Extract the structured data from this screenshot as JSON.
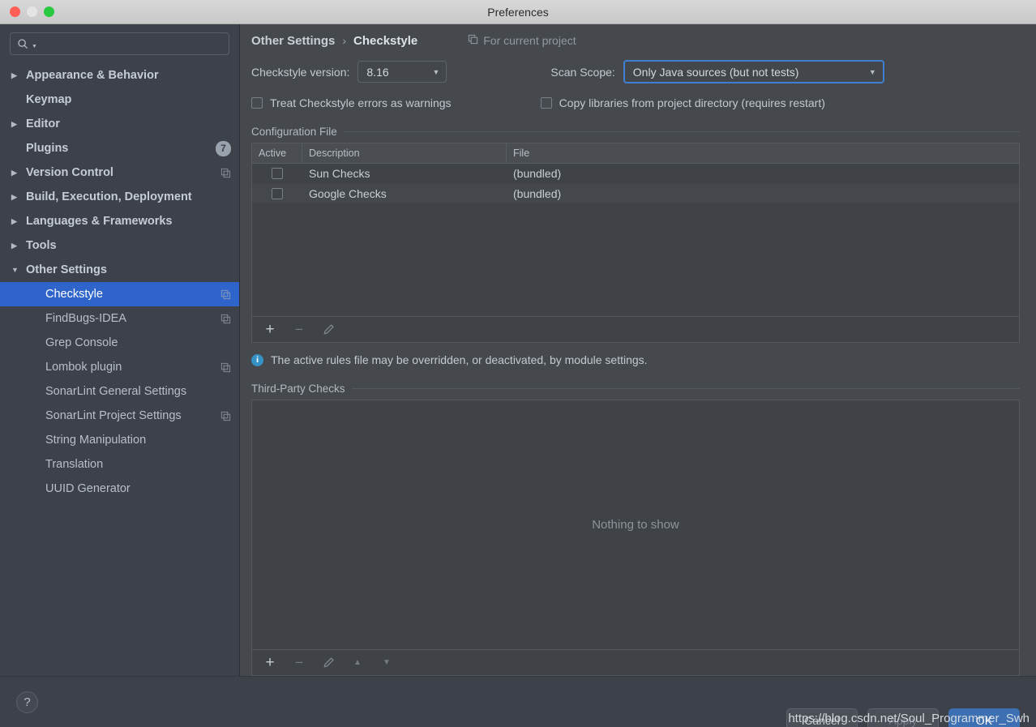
{
  "window": {
    "title": "Preferences",
    "traffic_lights": [
      "close",
      "minimize",
      "maximize"
    ],
    "colors": {
      "accent_selected": "#2f65ca",
      "accent_focus_border": "#3f7fd1",
      "primary_button": "#3d6fb3",
      "info_icon": "#3592c4",
      "sidebar_bg": "#3c414a",
      "content_bg": "#45494d"
    }
  },
  "sidebar": {
    "search": {
      "value": "",
      "placeholder": "",
      "icon": "search-icon",
      "dropdown_icon": "chevron-down-icon"
    },
    "items": [
      {
        "label": "Appearance & Behavior",
        "twisty": "▶",
        "level": 0,
        "selected": false,
        "badge": null,
        "module_icon": false
      },
      {
        "label": "Keymap",
        "twisty": "",
        "level": 0,
        "selected": false,
        "badge": null,
        "module_icon": false
      },
      {
        "label": "Editor",
        "twisty": "▶",
        "level": 0,
        "selected": false,
        "badge": null,
        "module_icon": false
      },
      {
        "label": "Plugins",
        "twisty": "",
        "level": 0,
        "selected": false,
        "badge": "7",
        "module_icon": false
      },
      {
        "label": "Version Control",
        "twisty": "▶",
        "level": 0,
        "selected": false,
        "badge": null,
        "module_icon": true
      },
      {
        "label": "Build, Execution, Deployment",
        "twisty": "▶",
        "level": 0,
        "selected": false,
        "badge": null,
        "module_icon": false
      },
      {
        "label": "Languages & Frameworks",
        "twisty": "▶",
        "level": 0,
        "selected": false,
        "badge": null,
        "module_icon": false
      },
      {
        "label": "Tools",
        "twisty": "▶",
        "level": 0,
        "selected": false,
        "badge": null,
        "module_icon": false
      },
      {
        "label": "Other Settings",
        "twisty": "▼",
        "level": 0,
        "selected": false,
        "badge": null,
        "module_icon": false
      },
      {
        "label": "Checkstyle",
        "twisty": "",
        "level": 1,
        "selected": true,
        "badge": null,
        "module_icon": true
      },
      {
        "label": "FindBugs-IDEA",
        "twisty": "",
        "level": 1,
        "selected": false,
        "badge": null,
        "module_icon": true
      },
      {
        "label": "Grep Console",
        "twisty": "",
        "level": 1,
        "selected": false,
        "badge": null,
        "module_icon": false
      },
      {
        "label": "Lombok plugin",
        "twisty": "",
        "level": 1,
        "selected": false,
        "badge": null,
        "module_icon": true
      },
      {
        "label": "SonarLint General Settings",
        "twisty": "",
        "level": 1,
        "selected": false,
        "badge": null,
        "module_icon": false
      },
      {
        "label": "SonarLint Project Settings",
        "twisty": "",
        "level": 1,
        "selected": false,
        "badge": null,
        "module_icon": true
      },
      {
        "label": "String Manipulation",
        "twisty": "",
        "level": 1,
        "selected": false,
        "badge": null,
        "module_icon": false
      },
      {
        "label": "Translation",
        "twisty": "",
        "level": 1,
        "selected": false,
        "badge": null,
        "module_icon": false
      },
      {
        "label": "UUID Generator",
        "twisty": "",
        "level": 1,
        "selected": false,
        "badge": null,
        "module_icon": false
      }
    ]
  },
  "main": {
    "breadcrumb": {
      "parent": "Other Settings",
      "separator": "›",
      "current": "Checkstyle"
    },
    "for_project_label": "For current project",
    "version_label": "Checkstyle version:",
    "version_value": "8.16",
    "scan_scope_label": "Scan Scope:",
    "scan_scope_value": "Only Java sources (but not tests)",
    "treat_errors_checkbox": {
      "label": "Treat Checkstyle errors as warnings",
      "checked": false
    },
    "copy_libraries_checkbox": {
      "label": "Copy libraries from project directory (requires restart)",
      "checked": false
    },
    "configuration_file": {
      "section_title": "Configuration File",
      "columns": [
        "Active",
        "Description",
        "File"
      ],
      "rows": [
        {
          "active": false,
          "description": "Sun Checks",
          "file": "(bundled)"
        },
        {
          "active": false,
          "description": "Google Checks",
          "file": "(bundled)"
        }
      ],
      "toolbar": [
        {
          "name": "add-button",
          "glyph": "+",
          "enabled": true
        },
        {
          "name": "remove-button",
          "glyph": "−",
          "enabled": false
        },
        {
          "name": "edit-button",
          "glyph": "pencil",
          "enabled": false
        }
      ]
    },
    "info_message": "The active rules file may be overridden, or deactivated, by module settings.",
    "third_party_checks": {
      "section_title": "Third-Party Checks",
      "empty_text": "Nothing to show",
      "toolbar": [
        {
          "name": "add-button",
          "glyph": "+",
          "enabled": true
        },
        {
          "name": "remove-button",
          "glyph": "−",
          "enabled": false
        },
        {
          "name": "edit-button",
          "glyph": "pencil",
          "enabled": false
        },
        {
          "name": "move-up-button",
          "glyph": "▲",
          "enabled": false
        },
        {
          "name": "move-down-button",
          "glyph": "▼",
          "enabled": false
        }
      ]
    }
  },
  "footer": {
    "help_glyph": "?",
    "cancel_label": "Cancel",
    "apply_label": "Apply",
    "ok_label": "OK"
  },
  "watermark": "https://blog.csdn.net/Soul_Programmer_Swh"
}
